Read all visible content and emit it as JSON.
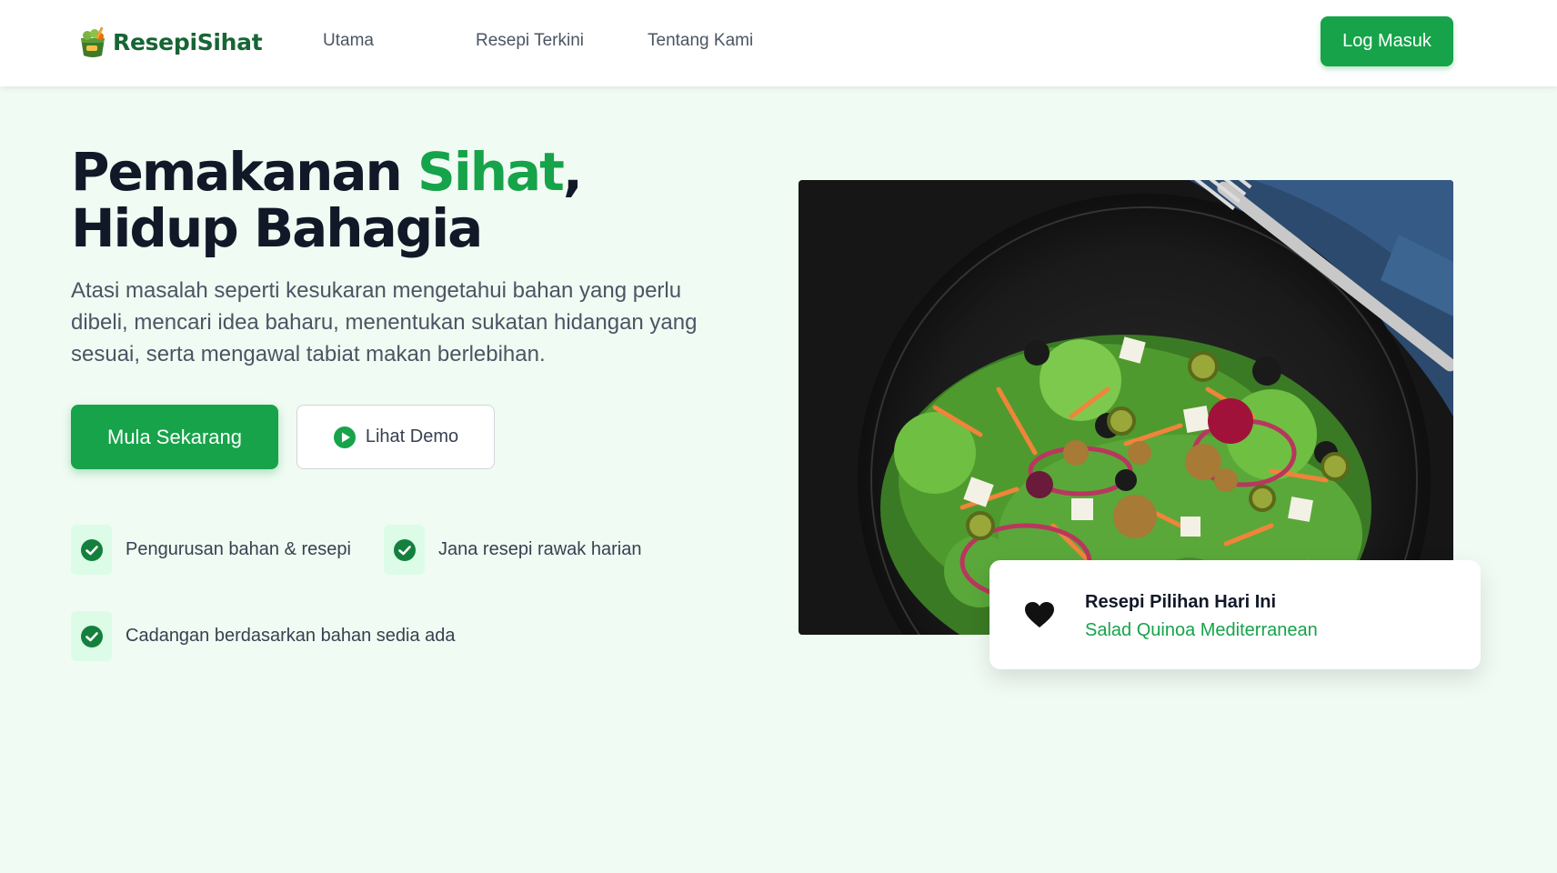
{
  "brand": {
    "name": "ResepiSihat",
    "color": "#166534"
  },
  "nav": {
    "links": [
      "Utama",
      "Resepi Terkini",
      "Tentang Kami"
    ],
    "login_label": "Log Masuk"
  },
  "hero": {
    "title_part1": "Pemakanan ",
    "title_accent": "Sihat",
    "title_part2": ", Hidup Bahagia",
    "description": "Atasi masalah seperti kesukaran mengetahui bahan yang perlu dibeli, mencari idea baharu, menentukan sukatan hidangan yang sesuai, serta mengawal tabiat makan berlebihan.",
    "primary_cta": "Mula Sekarang",
    "secondary_cta": "Lihat Demo",
    "features": [
      "Pengurusan bahan & resepi",
      "Jana resepi rawak harian",
      "Cadangan berdasarkan bahan sedia ada"
    ]
  },
  "featured": {
    "title": "Resepi Pilihan Hari Ini",
    "recipe_name": "Salad Quinoa Mediterranean"
  },
  "colors": {
    "accent": "#16a34a",
    "background": "#f0fbf3",
    "feature_bg": "#dcfce7"
  },
  "icons": {
    "logo": "salad-bowl-icon",
    "play": "play-circle-icon",
    "check": "check-circle-icon",
    "heart": "heart-icon"
  }
}
